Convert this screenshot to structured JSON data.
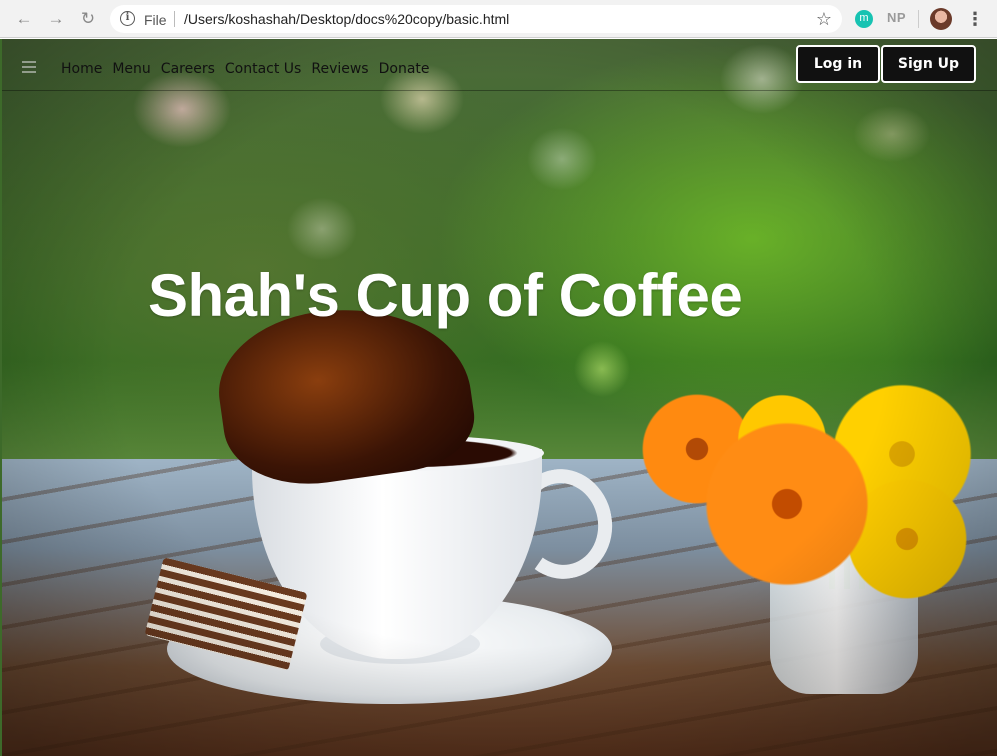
{
  "browser": {
    "back_icon": "arrow-left-icon",
    "forward_icon": "arrow-right-icon",
    "reload_icon": "reload-icon",
    "scheme_label": "File",
    "url": "/Users/koshashah/Desktop/docs%20copy/basic.html",
    "bookmark_icon": "star-icon",
    "extension_m": "m",
    "extension_np": "NP"
  },
  "site": {
    "nav": {
      "items": [
        {
          "label": "Home"
        },
        {
          "label": "Menu"
        },
        {
          "label": "Careers"
        },
        {
          "label": "Contact Us"
        },
        {
          "label": "Reviews"
        },
        {
          "label": "Donate"
        }
      ],
      "login_label": "Log in",
      "signup_label": "Sign Up"
    },
    "hero": {
      "title": "Shah's Cup of Coffee"
    }
  },
  "colors": {
    "button_bg": "#111111",
    "button_border": "#ffffff",
    "title_color": "#ffffff"
  }
}
